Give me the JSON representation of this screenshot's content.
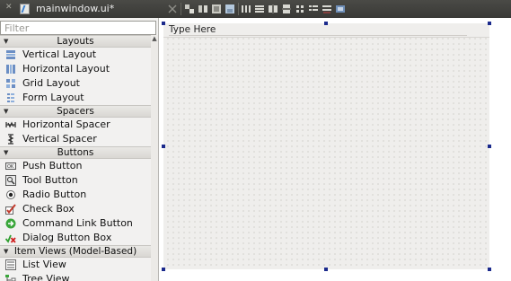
{
  "tab": {
    "title": "mainwindow.ui*"
  },
  "toolbar": {
    "icons": [
      "edit-widgets-icon",
      "edit-signals-icon",
      "edit-buddies-icon",
      "edit-tab-order-icon",
      "resource-icon",
      "layout-horizontal-icon",
      "layout-vertical-icon",
      "layout-h-splitter-icon",
      "layout-v-splitter-icon",
      "layout-grid-icon",
      "layout-form-icon",
      "break-layout-icon",
      "adjust-size-icon"
    ]
  },
  "filter": {
    "placeholder": "Filter"
  },
  "widgetbox": {
    "categories": [
      {
        "label": "Layouts",
        "items": [
          {
            "label": "Vertical Layout",
            "icon": "vertical-layout-icon"
          },
          {
            "label": "Horizontal Layout",
            "icon": "horizontal-layout-icon"
          },
          {
            "label": "Grid Layout",
            "icon": "grid-layout-icon"
          },
          {
            "label": "Form Layout",
            "icon": "form-layout-icon"
          }
        ]
      },
      {
        "label": "Spacers",
        "items": [
          {
            "label": "Horizontal Spacer",
            "icon": "horizontal-spacer-icon"
          },
          {
            "label": "Vertical Spacer",
            "icon": "vertical-spacer-icon"
          }
        ]
      },
      {
        "label": "Buttons",
        "items": [
          {
            "label": "Push Button",
            "icon": "push-button-icon"
          },
          {
            "label": "Tool Button",
            "icon": "tool-button-icon"
          },
          {
            "label": "Radio Button",
            "icon": "radio-button-icon"
          },
          {
            "label": "Check Box",
            "icon": "check-box-icon"
          },
          {
            "label": "Command Link Button",
            "icon": "command-link-icon"
          },
          {
            "label": "Dialog Button Box",
            "icon": "dialog-button-box-icon"
          }
        ]
      },
      {
        "label": "Item Views (Model-Based)",
        "items": [
          {
            "label": "List View",
            "icon": "list-view-icon"
          },
          {
            "label": "Tree View",
            "icon": "tree-view-icon"
          }
        ]
      }
    ]
  },
  "form": {
    "menu_placeholder": "Type Here"
  },
  "colors": {
    "handle": "#1b2a8c",
    "titlebar": "#3c3b37"
  }
}
